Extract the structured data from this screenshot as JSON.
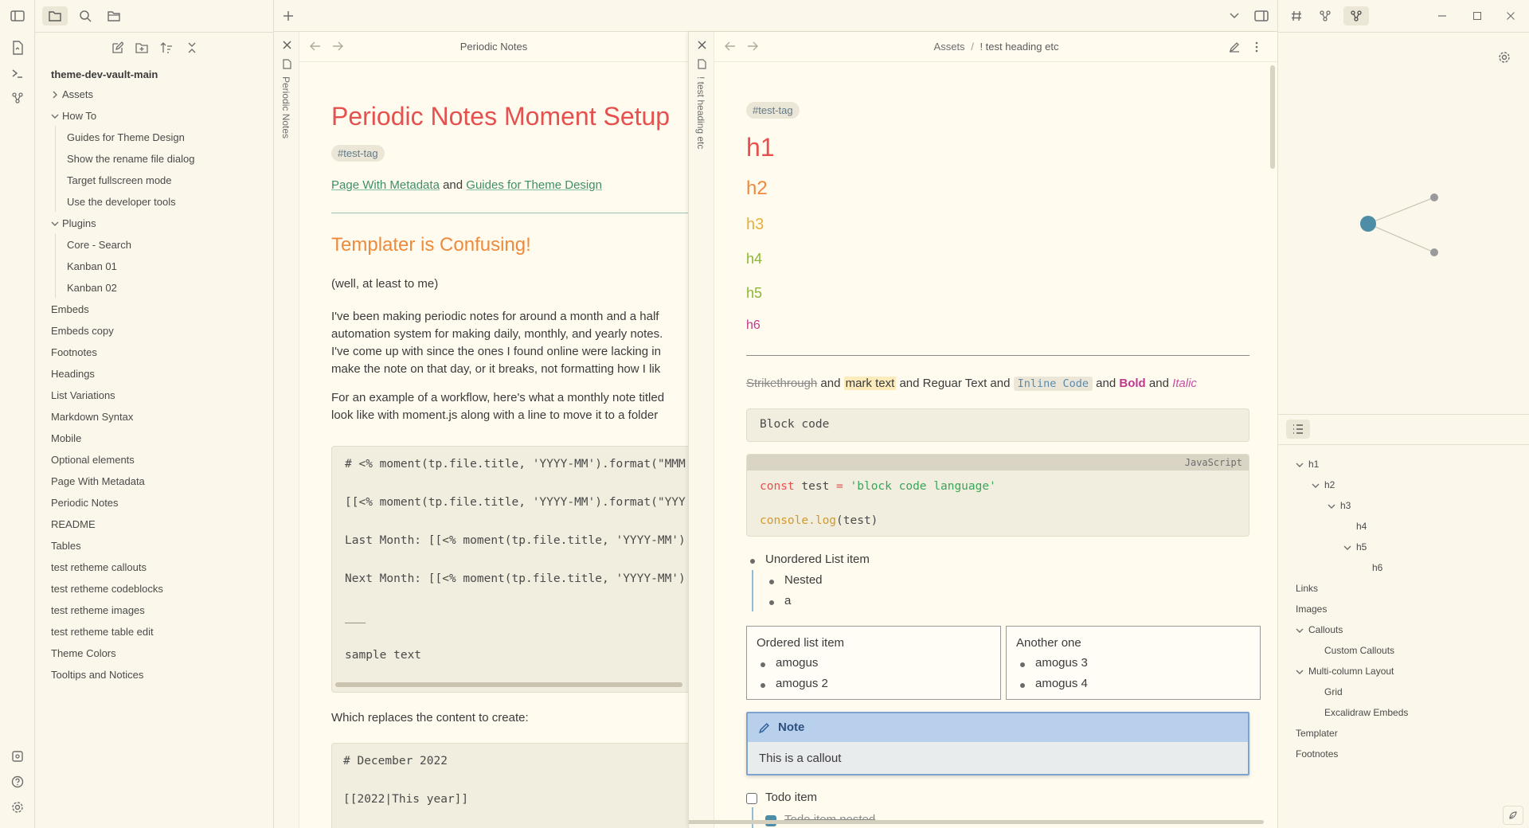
{
  "explorer": {
    "vault_name": "theme-dev-vault-main",
    "items": [
      {
        "label": "Assets",
        "type": "folder",
        "open": false
      },
      {
        "label": "How To",
        "type": "folder",
        "open": true
      },
      {
        "label": "Guides for Theme Design",
        "type": "file"
      },
      {
        "label": "Show the rename file dialog",
        "type": "file"
      },
      {
        "label": "Target fullscreen mode",
        "type": "file"
      },
      {
        "label": "Use the developer tools",
        "type": "file"
      },
      {
        "label": "Plugins",
        "type": "folder",
        "open": true
      },
      {
        "label": "Core - Search",
        "type": "file"
      },
      {
        "label": "Kanban 01",
        "type": "file"
      },
      {
        "label": "Kanban 02",
        "type": "file"
      },
      {
        "label": "Embeds",
        "type": "file"
      },
      {
        "label": "Embeds copy",
        "type": "file"
      },
      {
        "label": "Footnotes",
        "type": "file"
      },
      {
        "label": "Headings",
        "type": "file"
      },
      {
        "label": "List Variations",
        "type": "file"
      },
      {
        "label": "Markdown Syntax",
        "type": "file"
      },
      {
        "label": "Mobile",
        "type": "file"
      },
      {
        "label": "Optional elements",
        "type": "file"
      },
      {
        "label": "Page With Metadata",
        "type": "file"
      },
      {
        "label": "Periodic Notes",
        "type": "file"
      },
      {
        "label": "README",
        "type": "file"
      },
      {
        "label": "Tables",
        "type": "file"
      },
      {
        "label": "test retheme callouts",
        "type": "file"
      },
      {
        "label": "test retheme codeblocks",
        "type": "file"
      },
      {
        "label": "test retheme images",
        "type": "file"
      },
      {
        "label": "test retheme table edit",
        "type": "file"
      },
      {
        "label": "Theme Colors",
        "type": "file"
      },
      {
        "label": "Tooltips and Notices",
        "type": "file"
      }
    ]
  },
  "pane1": {
    "header_title": "Periodic Notes",
    "stack_label": "Periodic Notes",
    "title": "Periodic Notes Moment Setup",
    "tag": "#test-tag",
    "link1": "Page With Metadata",
    "link_and": "and",
    "link2": "Guides for Theme Design",
    "h2": "Templater is Confusing!",
    "p1": "(well, at least to me)",
    "p2_lines": [
      "I've been making periodic notes for around a month and a half",
      "automation system for making daily, monthly, and yearly notes.",
      "I've come up with since the ones I found online were lacking in",
      "make the note on that day, or it breaks, not formatting how I lik"
    ],
    "p3_lines": [
      "For an example of a workflow, here's what a monthly note titled",
      "look like with moment.js along with a line to move it to a folder"
    ],
    "code1": [
      "# <% moment(tp.file.title, 'YYYY-MM').format(\"MMM",
      "[[<% moment(tp.file.title, 'YYYY-MM').format(\"YYY",
      "Last Month: [[<% moment(tp.file.title, 'YYYY-MM')",
      "Next Month: [[<% moment(tp.file.title, 'YYYY-MM')",
      "___",
      "sample text"
    ],
    "p4": "Which replaces the content to create:",
    "code2": [
      "# December 2022",
      "[[2022|This year]]"
    ]
  },
  "pane2": {
    "breadcrumb_parent": "Assets",
    "breadcrumb_sep": "/",
    "breadcrumb_current": "! test heading etc",
    "stack_label": "! test heading etc",
    "tag": "#test-tag",
    "headings": [
      "h1",
      "h2",
      "h3",
      "h4",
      "h5",
      "h6"
    ],
    "heading_colors": [
      "#e5514f",
      "#ee8a3c",
      "#e6b13a",
      "#8bb833",
      "#8bb833",
      "#c0398e"
    ],
    "inline": {
      "strike": "Strikethrough",
      "and1": " and ",
      "mark": "mark text",
      "and2": " and Reguar Text and ",
      "code": "Inline Code",
      "and3": " and ",
      "bold": "Bold",
      "and4": " and ",
      "italic": "Italic"
    },
    "block_code": "Block code",
    "js_label": "JavaScript",
    "js_line1_kw": "const",
    "js_line1_var": " test ",
    "js_line1_eq": "=",
    "js_line1_str": " 'block code language'",
    "js_line2_fn": "console",
    "js_line2_rest": ".log",
    "js_line2_args": "(test)",
    "list": {
      "item": "Unordered List item",
      "nested": "Nested",
      "a": "a"
    },
    "col1": {
      "title": "Ordered list item",
      "items": [
        "amogus",
        "amogus 2"
      ]
    },
    "col2": {
      "title": "Another one",
      "items": [
        "amogus 3",
        "amogus 4"
      ]
    },
    "callout": {
      "title": "Note",
      "body": "This is a callout"
    },
    "todo": "Todo item",
    "todo_nested": "Todo item nested"
  },
  "outline": {
    "items": [
      {
        "label": "h1",
        "level": 0,
        "open": true
      },
      {
        "label": "h2",
        "level": 1,
        "open": true
      },
      {
        "label": "h3",
        "level": 2,
        "open": true
      },
      {
        "label": "h4",
        "level": 3
      },
      {
        "label": "h5",
        "level": 3,
        "open": true
      },
      {
        "label": "h6",
        "level": 4
      },
      {
        "label": "Links",
        "level": 0
      },
      {
        "label": "Images",
        "level": 0
      },
      {
        "label": "Callouts",
        "level": 0,
        "open": true
      },
      {
        "label": "Custom Callouts",
        "level": 1
      },
      {
        "label": "Multi-column Layout",
        "level": 0,
        "open": true
      },
      {
        "label": "Grid",
        "level": 1
      },
      {
        "label": "Excalidraw Embeds",
        "level": 1
      },
      {
        "label": "Templater",
        "level": 0
      },
      {
        "label": "Footnotes",
        "level": 0
      }
    ]
  },
  "colors": {
    "accent": "#4e8da6",
    "graph_node": "#4e8da6",
    "graph_leaf": "#9a9a9a",
    "callout_bg": "#b9d0ec",
    "callout_border": "#7fa3cf"
  }
}
